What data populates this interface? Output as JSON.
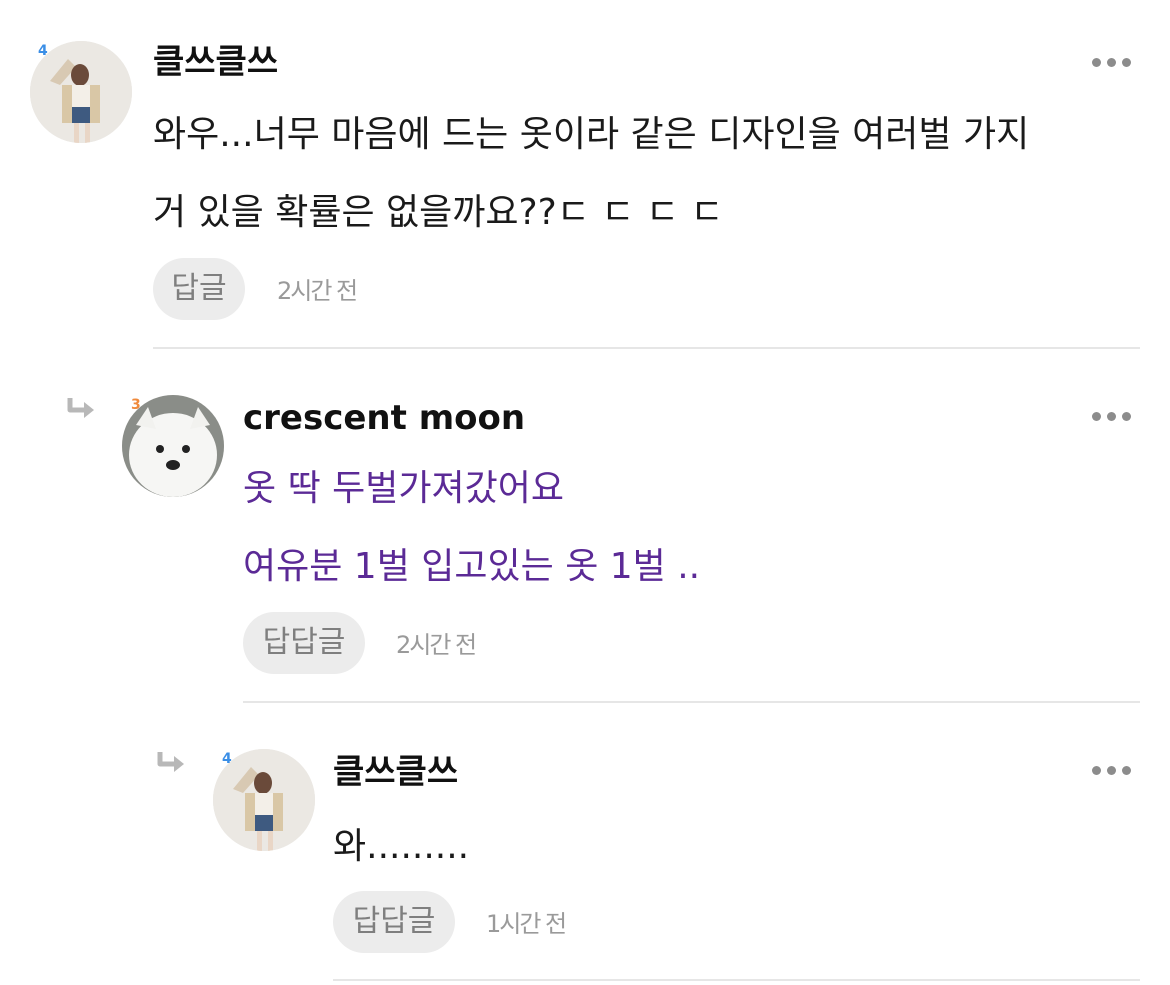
{
  "comments": [
    {
      "author": "클쓰클쓰",
      "level": "4",
      "lines": [
        "와우...너무 마음에 드는 옷이라 같은 디자인을 여러벌 가지",
        "거 있을 확률은 없을까요??ㄷ ㄷ ㄷ ㄷ"
      ],
      "reply_label": "답글",
      "time": "2시간 전"
    },
    {
      "author": "crescent moon",
      "level": "3",
      "lines": [
        "옷 딱 두벌가져갔어요",
        "여유분 1벌 입고있는 옷 1벌 .."
      ],
      "reply_label": "답답글",
      "time": "2시간 전"
    },
    {
      "author": "클쓰클쓰",
      "level": "4",
      "lines": [
        "와........."
      ],
      "reply_label": "답답글",
      "time": "1시간 전"
    }
  ],
  "colors": {
    "reply_text": "#5b2a96",
    "level_blue": "#3a8ee6",
    "level_orange": "#f08a3c",
    "muted": "#9a9a9a"
  },
  "icons": {
    "more": "more-dots-icon",
    "reply_arrow": "reply-arrow-icon"
  }
}
